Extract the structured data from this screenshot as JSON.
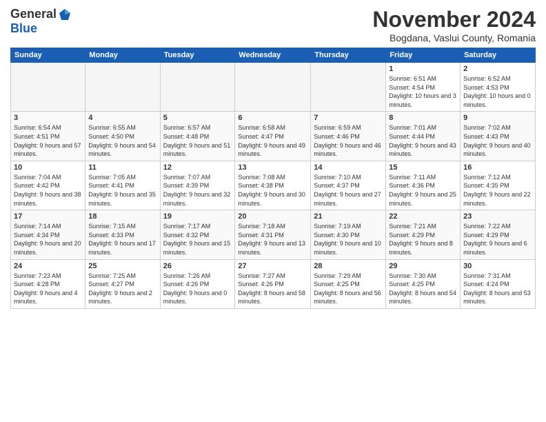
{
  "header": {
    "logo_general": "General",
    "logo_blue": "Blue",
    "month_title": "November 2024",
    "location": "Bogdana, Vaslui County, Romania"
  },
  "weekdays": [
    "Sunday",
    "Monday",
    "Tuesday",
    "Wednesday",
    "Thursday",
    "Friday",
    "Saturday"
  ],
  "weeks": [
    [
      {
        "day": "",
        "info": ""
      },
      {
        "day": "",
        "info": ""
      },
      {
        "day": "",
        "info": ""
      },
      {
        "day": "",
        "info": ""
      },
      {
        "day": "",
        "info": ""
      },
      {
        "day": "1",
        "info": "Sunrise: 6:51 AM\nSunset: 4:54 PM\nDaylight: 10 hours\nand 3 minutes."
      },
      {
        "day": "2",
        "info": "Sunrise: 6:52 AM\nSunset: 4:53 PM\nDaylight: 10 hours\nand 0 minutes."
      }
    ],
    [
      {
        "day": "3",
        "info": "Sunrise: 6:54 AM\nSunset: 4:51 PM\nDaylight: 9 hours\nand 57 minutes."
      },
      {
        "day": "4",
        "info": "Sunrise: 6:55 AM\nSunset: 4:50 PM\nDaylight: 9 hours\nand 54 minutes."
      },
      {
        "day": "5",
        "info": "Sunrise: 6:57 AM\nSunset: 4:48 PM\nDaylight: 9 hours\nand 51 minutes."
      },
      {
        "day": "6",
        "info": "Sunrise: 6:58 AM\nSunset: 4:47 PM\nDaylight: 9 hours\nand 49 minutes."
      },
      {
        "day": "7",
        "info": "Sunrise: 6:59 AM\nSunset: 4:46 PM\nDaylight: 9 hours\nand 46 minutes."
      },
      {
        "day": "8",
        "info": "Sunrise: 7:01 AM\nSunset: 4:44 PM\nDaylight: 9 hours\nand 43 minutes."
      },
      {
        "day": "9",
        "info": "Sunrise: 7:02 AM\nSunset: 4:43 PM\nDaylight: 9 hours\nand 40 minutes."
      }
    ],
    [
      {
        "day": "10",
        "info": "Sunrise: 7:04 AM\nSunset: 4:42 PM\nDaylight: 9 hours\nand 38 minutes."
      },
      {
        "day": "11",
        "info": "Sunrise: 7:05 AM\nSunset: 4:41 PM\nDaylight: 9 hours\nand 35 minutes."
      },
      {
        "day": "12",
        "info": "Sunrise: 7:07 AM\nSunset: 4:39 PM\nDaylight: 9 hours\nand 32 minutes."
      },
      {
        "day": "13",
        "info": "Sunrise: 7:08 AM\nSunset: 4:38 PM\nDaylight: 9 hours\nand 30 minutes."
      },
      {
        "day": "14",
        "info": "Sunrise: 7:10 AM\nSunset: 4:37 PM\nDaylight: 9 hours\nand 27 minutes."
      },
      {
        "day": "15",
        "info": "Sunrise: 7:11 AM\nSunset: 4:36 PM\nDaylight: 9 hours\nand 25 minutes."
      },
      {
        "day": "16",
        "info": "Sunrise: 7:12 AM\nSunset: 4:35 PM\nDaylight: 9 hours\nand 22 minutes."
      }
    ],
    [
      {
        "day": "17",
        "info": "Sunrise: 7:14 AM\nSunset: 4:34 PM\nDaylight: 9 hours\nand 20 minutes."
      },
      {
        "day": "18",
        "info": "Sunrise: 7:15 AM\nSunset: 4:33 PM\nDaylight: 9 hours\nand 17 minutes."
      },
      {
        "day": "19",
        "info": "Sunrise: 7:17 AM\nSunset: 4:32 PM\nDaylight: 9 hours\nand 15 minutes."
      },
      {
        "day": "20",
        "info": "Sunrise: 7:18 AM\nSunset: 4:31 PM\nDaylight: 9 hours\nand 13 minutes."
      },
      {
        "day": "21",
        "info": "Sunrise: 7:19 AM\nSunset: 4:30 PM\nDaylight: 9 hours\nand 10 minutes."
      },
      {
        "day": "22",
        "info": "Sunrise: 7:21 AM\nSunset: 4:29 PM\nDaylight: 9 hours\nand 8 minutes."
      },
      {
        "day": "23",
        "info": "Sunrise: 7:22 AM\nSunset: 4:29 PM\nDaylight: 9 hours\nand 6 minutes."
      }
    ],
    [
      {
        "day": "24",
        "info": "Sunrise: 7:23 AM\nSunset: 4:28 PM\nDaylight: 9 hours\nand 4 minutes."
      },
      {
        "day": "25",
        "info": "Sunrise: 7:25 AM\nSunset: 4:27 PM\nDaylight: 9 hours\nand 2 minutes."
      },
      {
        "day": "26",
        "info": "Sunrise: 7:26 AM\nSunset: 4:26 PM\nDaylight: 9 hours\nand 0 minutes."
      },
      {
        "day": "27",
        "info": "Sunrise: 7:27 AM\nSunset: 4:26 PM\nDaylight: 8 hours\nand 58 minutes."
      },
      {
        "day": "28",
        "info": "Sunrise: 7:29 AM\nSunset: 4:25 PM\nDaylight: 8 hours\nand 56 minutes."
      },
      {
        "day": "29",
        "info": "Sunrise: 7:30 AM\nSunset: 4:25 PM\nDaylight: 8 hours\nand 54 minutes."
      },
      {
        "day": "30",
        "info": "Sunrise: 7:31 AM\nSunset: 4:24 PM\nDaylight: 8 hours\nand 53 minutes."
      }
    ]
  ]
}
